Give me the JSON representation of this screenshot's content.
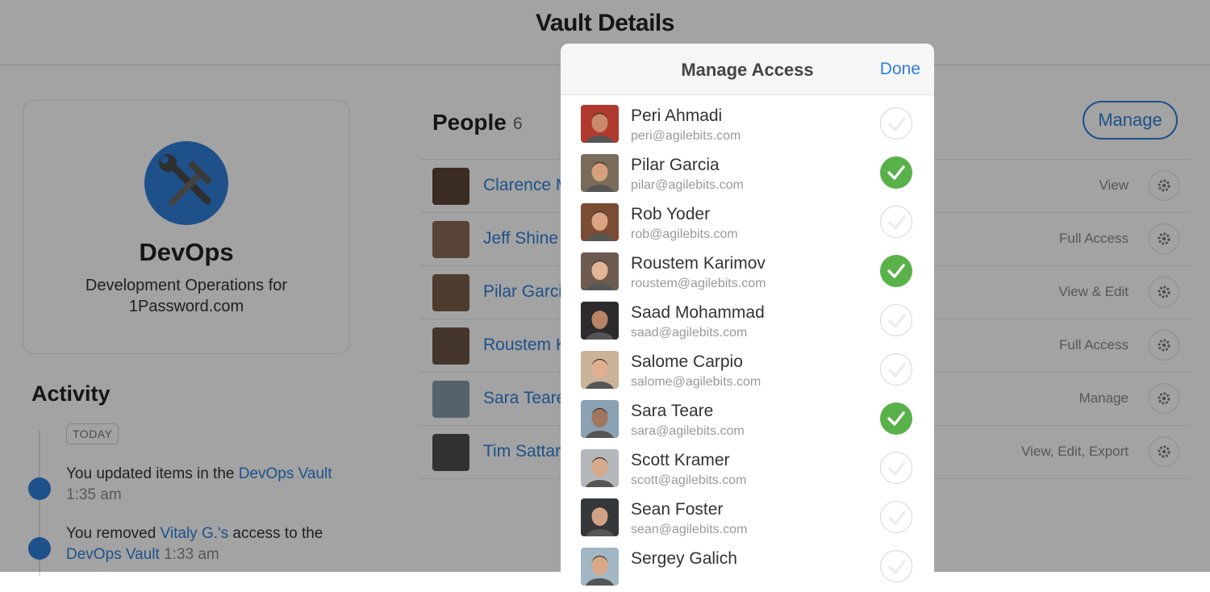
{
  "page": {
    "title": "Vault Details"
  },
  "vault": {
    "name": "DevOps",
    "description": "Development Operations for 1Password.com",
    "icon": "tools-icon",
    "icon_color": "#2f7fd8"
  },
  "activity": {
    "title": "Activity",
    "day_label": "TODAY",
    "entries": [
      {
        "prefix": "You updated items in the ",
        "link": "DevOps Vault",
        "suffix": "",
        "time": " 1:35 am"
      },
      {
        "prefix": "You removed ",
        "link": "Vitaly G.'s",
        "suffix": " access to the ",
        "link2": "DevOps Vault",
        "time": " 1:33 am"
      }
    ]
  },
  "people": {
    "title": "People",
    "count": "6",
    "manage_label": "Manage",
    "rows": [
      {
        "name": "Clarence M",
        "access": "View"
      },
      {
        "name": "Jeff Shine",
        "access": "Full Access"
      },
      {
        "name": "Pilar Garci",
        "access": "View & Edit"
      },
      {
        "name": "Roustem K",
        "access": "Full Access"
      },
      {
        "name": "Sara Teare",
        "access": "Manage"
      },
      {
        "name": "Tim Sattar",
        "access": "View, Edit, Export"
      }
    ]
  },
  "modal": {
    "title": "Manage Access",
    "done_label": "Done",
    "accent": "#2f7fd8",
    "check_color": "#59b14a",
    "users": [
      {
        "name": "Peri Ahmadi",
        "email": "peri@agilebits.com",
        "checked": false,
        "skin": "#c98a6a",
        "bg": "#b13a2e"
      },
      {
        "name": "Pilar Garcia",
        "email": "pilar@agilebits.com",
        "checked": true,
        "skin": "#d6a07c",
        "bg": "#7a6c5a"
      },
      {
        "name": "Rob Yoder",
        "email": "rob@agilebits.com",
        "checked": false,
        "skin": "#d9a384",
        "bg": "#7a4c34"
      },
      {
        "name": "Roustem Karimov",
        "email": "roustem@agilebits.com",
        "checked": true,
        "skin": "#e2b596",
        "bg": "#6e5b4f"
      },
      {
        "name": "Saad Mohammad",
        "email": "saad@agilebits.com",
        "checked": false,
        "skin": "#b88466",
        "bg": "#2c2a2d"
      },
      {
        "name": "Salome Carpio",
        "email": "salome@agilebits.com",
        "checked": false,
        "skin": "#e0b090",
        "bg": "#c9b49a"
      },
      {
        "name": "Sara Teare",
        "email": "sara@agilebits.com",
        "checked": true,
        "skin": "#a0765e",
        "bg": "#8aa2b4"
      },
      {
        "name": "Scott Kramer",
        "email": "scott@agilebits.com",
        "checked": false,
        "skin": "#d7a98b",
        "bg": "#b4b8bc"
      },
      {
        "name": "Sean Foster",
        "email": "sean@agilebits.com",
        "checked": false,
        "skin": "#d2a286",
        "bg": "#35383a"
      },
      {
        "name": "Sergey Galich",
        "email": "",
        "checked": false,
        "skin": "#d9a887",
        "bg": "#a3b6c4"
      }
    ]
  }
}
